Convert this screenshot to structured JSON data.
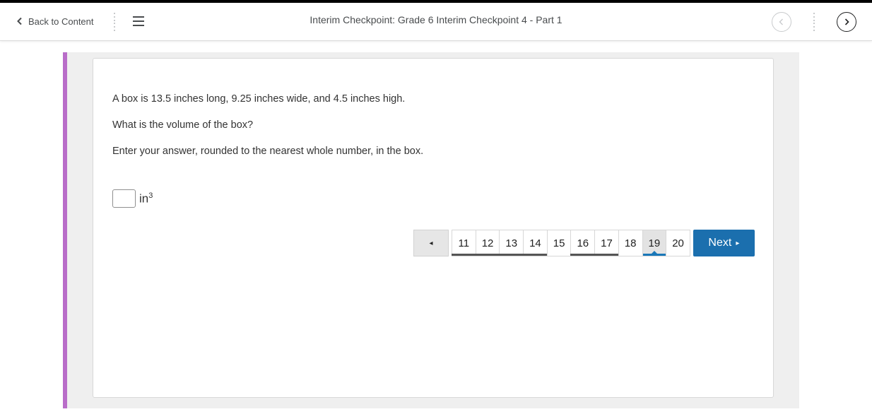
{
  "header": {
    "back_label": "Back to Content",
    "title": "Interim Checkpoint: Grade 6 Interim Checkpoint 4 - Part 1",
    "icons": {
      "back": "chevron-left-icon",
      "menu": "hamburger-menu-icon",
      "prev": "circle-chevron-left-icon",
      "next": "circle-chevron-right-icon"
    }
  },
  "question": {
    "line1": "A box is 13.5 inches long, 9.25 inches wide, and 4.5 inches high.",
    "line2": "What is the volume of the box?",
    "line3": "Enter your answer, rounded to the nearest whole number, in the box.",
    "answer_value": "",
    "unit": "in",
    "unit_exponent": "3"
  },
  "pagination": {
    "prev_symbol": "◂",
    "pages": [
      "11",
      "12",
      "13",
      "14",
      "15",
      "16",
      "17",
      "18",
      "19",
      "20"
    ],
    "current": "19",
    "next_label": "Next",
    "next_symbol": "▸"
  },
  "colors": {
    "accent_bar": "#b96dc9",
    "next_button": "#1b6fae",
    "current_indicator": "#1a78b8"
  }
}
